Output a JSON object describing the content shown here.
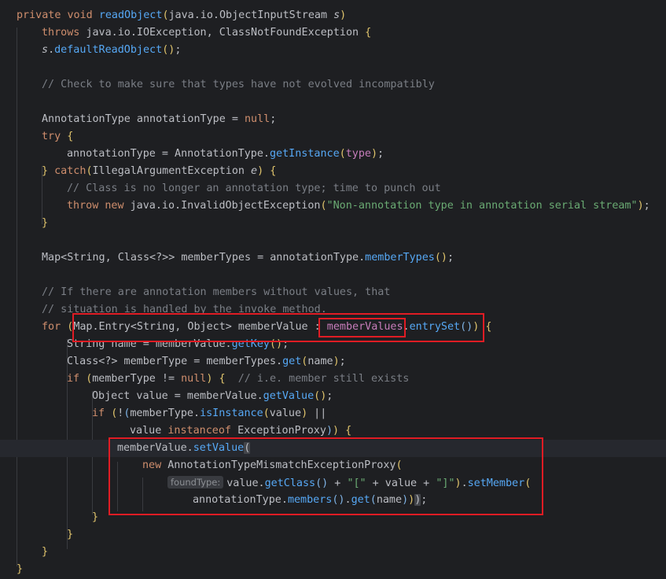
{
  "editor": {
    "lines": [
      {
        "indent": 0,
        "tokens": [
          [
            "keyword",
            "private void "
          ],
          [
            "method",
            "readObject"
          ],
          [
            "paren-y",
            "("
          ],
          [
            "plain",
            "java.io.ObjectInputStream "
          ],
          [
            "param",
            "s"
          ],
          [
            "paren-y",
            ")"
          ]
        ]
      },
      {
        "indent": 1,
        "tokens": [
          [
            "keyword",
            "throws "
          ],
          [
            "plain",
            "java.io.IOException, ClassNotFoundException "
          ],
          [
            "paren-y",
            "{"
          ]
        ]
      },
      {
        "indent": 1,
        "tokens": [
          [
            "param",
            "s"
          ],
          [
            "plain",
            "."
          ],
          [
            "method",
            "defaultReadObject"
          ],
          [
            "paren-y",
            "()"
          ],
          [
            "plain",
            ";"
          ]
        ]
      },
      {
        "indent": 1,
        "tokens": []
      },
      {
        "indent": 1,
        "tokens": [
          [
            "comment",
            "// Check to make sure that types have not evolved incompatibly"
          ]
        ]
      },
      {
        "indent": 1,
        "tokens": []
      },
      {
        "indent": 1,
        "tokens": [
          [
            "plain",
            "AnnotationType annotationType = "
          ],
          [
            "keyword",
            "null"
          ],
          [
            "plain",
            ";"
          ]
        ]
      },
      {
        "indent": 1,
        "tokens": [
          [
            "keyword",
            "try "
          ],
          [
            "paren-y",
            "{"
          ]
        ]
      },
      {
        "indent": 2,
        "tokens": [
          [
            "plain",
            "annotationType = AnnotationType."
          ],
          [
            "method",
            "getInstance"
          ],
          [
            "paren-y",
            "("
          ],
          [
            "field",
            "type"
          ],
          [
            "paren-y",
            ")"
          ],
          [
            "plain",
            ";"
          ]
        ]
      },
      {
        "indent": 1,
        "tokens": [
          [
            "paren-y",
            "} "
          ],
          [
            "keyword",
            "catch"
          ],
          [
            "paren-y",
            "("
          ],
          [
            "plain",
            "IllegalArgumentException "
          ],
          [
            "param",
            "e"
          ],
          [
            "paren-y",
            ") {"
          ]
        ]
      },
      {
        "indent": 2,
        "tokens": [
          [
            "comment",
            "// Class is no longer an annotation type; time to punch out"
          ]
        ]
      },
      {
        "indent": 2,
        "tokens": [
          [
            "keyword",
            "throw new "
          ],
          [
            "plain",
            "java.io.InvalidObjectException"
          ],
          [
            "paren-y",
            "("
          ],
          [
            "string",
            "\"Non-annotation type in annotation serial stream\""
          ],
          [
            "paren-y",
            ")"
          ],
          [
            "plain",
            ";"
          ]
        ]
      },
      {
        "indent": 1,
        "tokens": [
          [
            "paren-y",
            "}"
          ]
        ]
      },
      {
        "indent": 1,
        "tokens": []
      },
      {
        "indent": 1,
        "tokens": [
          [
            "plain",
            "Map<String, Class<?>> memberTypes = annotationType."
          ],
          [
            "method",
            "memberTypes"
          ],
          [
            "paren-y",
            "()"
          ],
          [
            "plain",
            ";"
          ]
        ]
      },
      {
        "indent": 1,
        "tokens": []
      },
      {
        "indent": 1,
        "tokens": [
          [
            "comment",
            "// If there are annotation members without values, that"
          ]
        ]
      },
      {
        "indent": 1,
        "tokens": [
          [
            "comment",
            "// situation is handled by the invoke method."
          ]
        ]
      },
      {
        "indent": 1,
        "tokens": [
          [
            "keyword",
            "for "
          ],
          [
            "paren-y",
            "("
          ],
          [
            "plain",
            "Map.Entry<String, Object> memberValue : "
          ],
          [
            "field",
            "memberValues"
          ],
          [
            "plain",
            "."
          ],
          [
            "method",
            "entrySet"
          ],
          [
            "paren-b",
            "()"
          ],
          [
            "paren-y",
            ") {"
          ]
        ]
      },
      {
        "indent": 2,
        "tokens": [
          [
            "plain",
            "String name = memberValue."
          ],
          [
            "method",
            "getKey"
          ],
          [
            "paren-y",
            "()"
          ],
          [
            "plain",
            ";"
          ]
        ]
      },
      {
        "indent": 2,
        "tokens": [
          [
            "plain",
            "Class<?> memberType = memberTypes."
          ],
          [
            "method",
            "get"
          ],
          [
            "paren-y",
            "("
          ],
          [
            "plain",
            "name"
          ],
          [
            "paren-y",
            ")"
          ],
          [
            "plain",
            ";"
          ]
        ]
      },
      {
        "indent": 2,
        "tokens": [
          [
            "keyword",
            "if "
          ],
          [
            "paren-y",
            "("
          ],
          [
            "plain",
            "memberType != "
          ],
          [
            "keyword",
            "null"
          ],
          [
            "paren-y",
            ") {  "
          ],
          [
            "comment",
            "// i.e. member still exists"
          ]
        ]
      },
      {
        "indent": 3,
        "tokens": [
          [
            "plain",
            "Object value = memberValue."
          ],
          [
            "method",
            "getValue"
          ],
          [
            "paren-y",
            "()"
          ],
          [
            "plain",
            ";"
          ]
        ]
      },
      {
        "indent": 3,
        "tokens": [
          [
            "keyword",
            "if "
          ],
          [
            "paren-y",
            "("
          ],
          [
            "plain",
            "!"
          ],
          [
            "paren-b",
            "("
          ],
          [
            "plain",
            "memberType."
          ],
          [
            "method",
            "isInstance"
          ],
          [
            "paren-y",
            "("
          ],
          [
            "plain",
            "value"
          ],
          [
            "paren-y",
            ")"
          ],
          [
            "plain",
            " ||"
          ]
        ]
      },
      {
        "indent": 4.5,
        "tokens": [
          [
            "plain",
            "value "
          ],
          [
            "keyword",
            "instanceof "
          ],
          [
            "plain",
            "ExceptionProxy"
          ],
          [
            "paren-b",
            ")"
          ],
          [
            "paren-y",
            ") {"
          ]
        ]
      },
      {
        "indent": 4,
        "current": true,
        "tokens": [
          [
            "plain",
            "memberValue."
          ],
          [
            "method",
            "setValue"
          ],
          [
            "bracket-sel",
            "("
          ]
        ]
      },
      {
        "indent": 5,
        "tokens": [
          [
            "keyword",
            "new "
          ],
          [
            "plain",
            "AnnotationTypeMismatchExceptionProxy"
          ],
          [
            "paren-y",
            "("
          ]
        ]
      },
      {
        "indent": 6,
        "tokens": [
          [
            "hint",
            "foundType:"
          ],
          [
            "plain",
            "value."
          ],
          [
            "method",
            "getClass"
          ],
          [
            "paren-b",
            "()"
          ],
          [
            "plain",
            " + "
          ],
          [
            "string",
            "\"[\""
          ],
          [
            "plain",
            " + value + "
          ],
          [
            "string",
            "\"]\""
          ],
          [
            "paren-y",
            ")"
          ],
          [
            "plain",
            "."
          ],
          [
            "method",
            "setMember"
          ],
          [
            "paren-y",
            "("
          ]
        ]
      },
      {
        "indent": 7,
        "tokens": [
          [
            "plain",
            "annotationType."
          ],
          [
            "method",
            "members"
          ],
          [
            "paren-b",
            "()"
          ],
          [
            "plain",
            "."
          ],
          [
            "method",
            "get"
          ],
          [
            "paren-b",
            "("
          ],
          [
            "plain",
            "name"
          ],
          [
            "paren-b",
            ")"
          ],
          [
            "paren-y",
            ")"
          ],
          [
            "bracket-sel",
            ")"
          ],
          [
            "plain",
            ";"
          ]
        ]
      },
      {
        "indent": 3,
        "tokens": [
          [
            "paren-y",
            "}"
          ]
        ]
      },
      {
        "indent": 2,
        "tokens": [
          [
            "paren-y",
            "}"
          ]
        ]
      },
      {
        "indent": 1,
        "tokens": [
          [
            "paren-y",
            "}"
          ]
        ]
      },
      {
        "indent": 0,
        "tokens": [
          [
            "paren-y",
            "}"
          ]
        ]
      }
    ]
  },
  "annotation": {
    "color": "#e01c24"
  }
}
